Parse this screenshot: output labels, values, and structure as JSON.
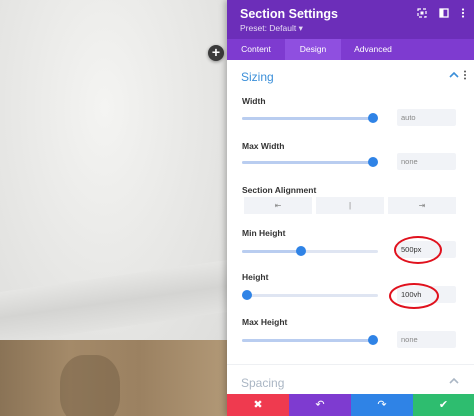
{
  "panel": {
    "title": "Section Settings",
    "preset": "Preset: Default ▾",
    "tabs": [
      "Content",
      "Design",
      "Advanced"
    ],
    "active_tab": "Design"
  },
  "sizing": {
    "heading": "Sizing",
    "width": {
      "label": "Width",
      "value": "auto",
      "slider": 1.0
    },
    "max_width": {
      "label": "Max Width",
      "value": "none",
      "slider": 1.0
    },
    "section_alignment": {
      "label": "Section Alignment",
      "options": [
        "⇤",
        "|",
        "⇥"
      ]
    },
    "min_height": {
      "label": "Min Height",
      "value": "500px",
      "slider": 0.43
    },
    "height": {
      "label": "Height",
      "value": "100vh",
      "slider": 0.0
    },
    "max_height": {
      "label": "Max Height",
      "value": "none",
      "slider": 1.0
    }
  },
  "spacing": {
    "heading": "Spacing"
  },
  "icons": {
    "header": [
      "expand-icon",
      "sidebar-toggle-icon",
      "more-icon"
    ],
    "add": "+",
    "collapse": "^"
  },
  "footer": {
    "buttons": [
      "✖",
      "↶",
      "↷",
      "✔"
    ],
    "colors": [
      "#ef3a4f",
      "#7e3bd0",
      "#2f83e6",
      "#2ebd6f"
    ]
  },
  "colors": {
    "accent_purple": "#6c2eb9",
    "accent_blue": "#2f83e6",
    "highlight_red": "#e0111d"
  }
}
